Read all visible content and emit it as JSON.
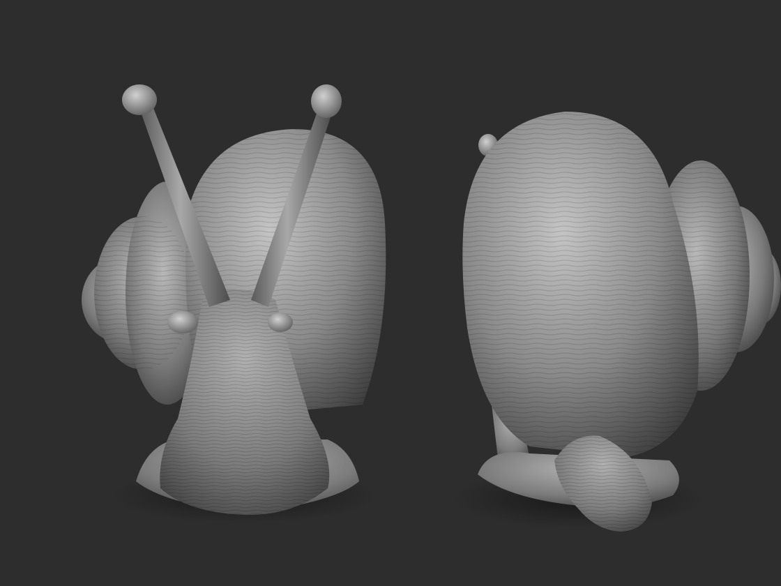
{
  "scene": {
    "kind": "3d-sculpt-render",
    "subject": "snail",
    "background_color": "#2d2d2d",
    "material_colors": {
      "highlight": "#c4c4c4",
      "mid": "#8a8a8a",
      "shadow": "#3e3e3e"
    },
    "views": [
      {
        "id": "front",
        "name": "snail-front-view"
      },
      {
        "id": "rear",
        "name": "snail-rear-three-quarter-view"
      }
    ]
  }
}
